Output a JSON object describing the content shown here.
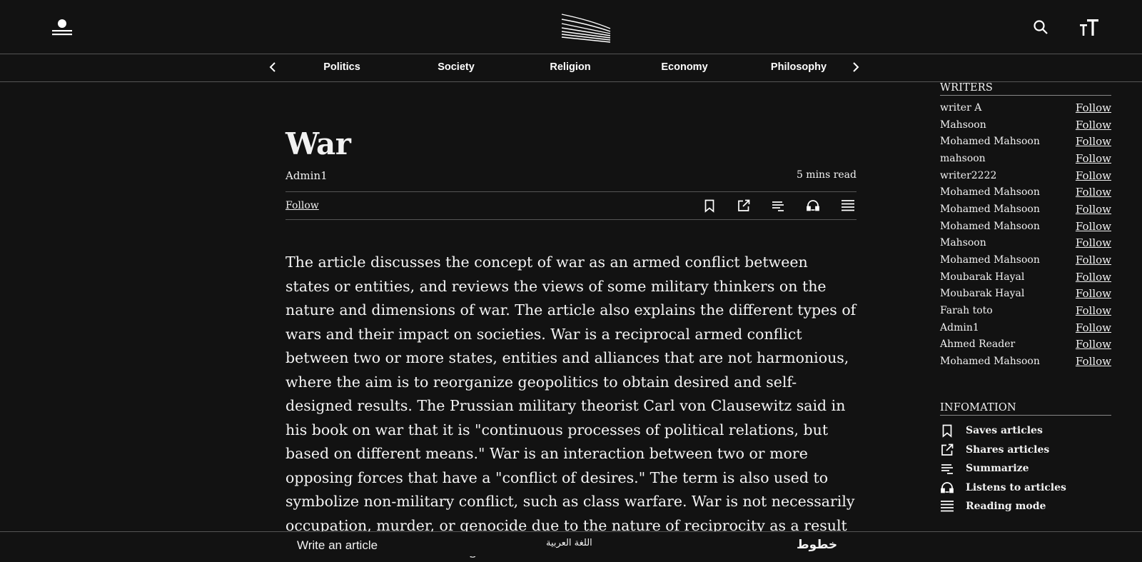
{
  "header": {
    "user_icon": "user-menu-icon",
    "logo_icon": "site-logo",
    "search_icon": "search-icon",
    "textsize_icon": "text-size-icon"
  },
  "categories": {
    "items": [
      "Politics",
      "Society",
      "Religion",
      "Economy",
      "Philosophy"
    ],
    "prev_icon": "chevron-left-icon",
    "next_icon": "chevron-right-icon"
  },
  "article": {
    "title": "War",
    "author": "Admin1",
    "read_time": "5 mins read",
    "follow_label": "Follow",
    "tools": [
      "bookmark-icon",
      "share-icon",
      "summarize-icon",
      "listen-icon",
      "reading-mode-icon"
    ],
    "body": "The article discusses the concept of war as an armed conflict between states or entities, and reviews the views of some military thinkers on the nature and dimensions of war. The article also explains the different types of wars and their impact on societies. War is a reciprocal armed conflict between two or more states, entities and alliances that are not harmonious, where the aim is to reorganize geopolitics to obtain desired and self-designed results. The Prussian military theorist Carl von Clausewitz said in his book on war that it is \"continuous processes of political relations, but based on different means.\" War is an interaction between two or more opposing forces that have a \"conflict of desires.\" The term is also used to symbolize non-military conflict, such as class warfare. War is not necessarily occupation, murder, or genocide due to the nature of reciprocity as a result of the violence, or the organized nature of the units involved. A civil war"
  },
  "sidebar": {
    "writers_heading": "WRITERS",
    "follow_label": "Follow",
    "writers": [
      "writer A",
      "Mahsoon",
      "Mohamed Mahsoon",
      "mahsoon",
      "writer2222",
      "Mohamed Mahsoon",
      "Mohamed Mahsoon",
      "Mohamed Mahsoon",
      "Mahsoon",
      "Mohamed Mahsoon",
      "Moubarak Hayal",
      "Moubarak Hayal",
      "Farah toto",
      "Admin1",
      "Ahmed Reader",
      "Mohamed Mahsoon"
    ],
    "info_heading": "INFOMATION",
    "info": [
      {
        "icon": "bookmark-icon",
        "label": "Saves articles"
      },
      {
        "icon": "share-icon",
        "label": "Shares articles"
      },
      {
        "icon": "summarize-icon",
        "label": "Summarize"
      },
      {
        "icon": "listen-icon",
        "label": "Listens to articles"
      },
      {
        "icon": "reading-mode-icon",
        "label": "Reading mode"
      }
    ]
  },
  "footer": {
    "write_label": "Write an article",
    "language_label": "اللغة العربية",
    "logo_text": "خطوط"
  }
}
